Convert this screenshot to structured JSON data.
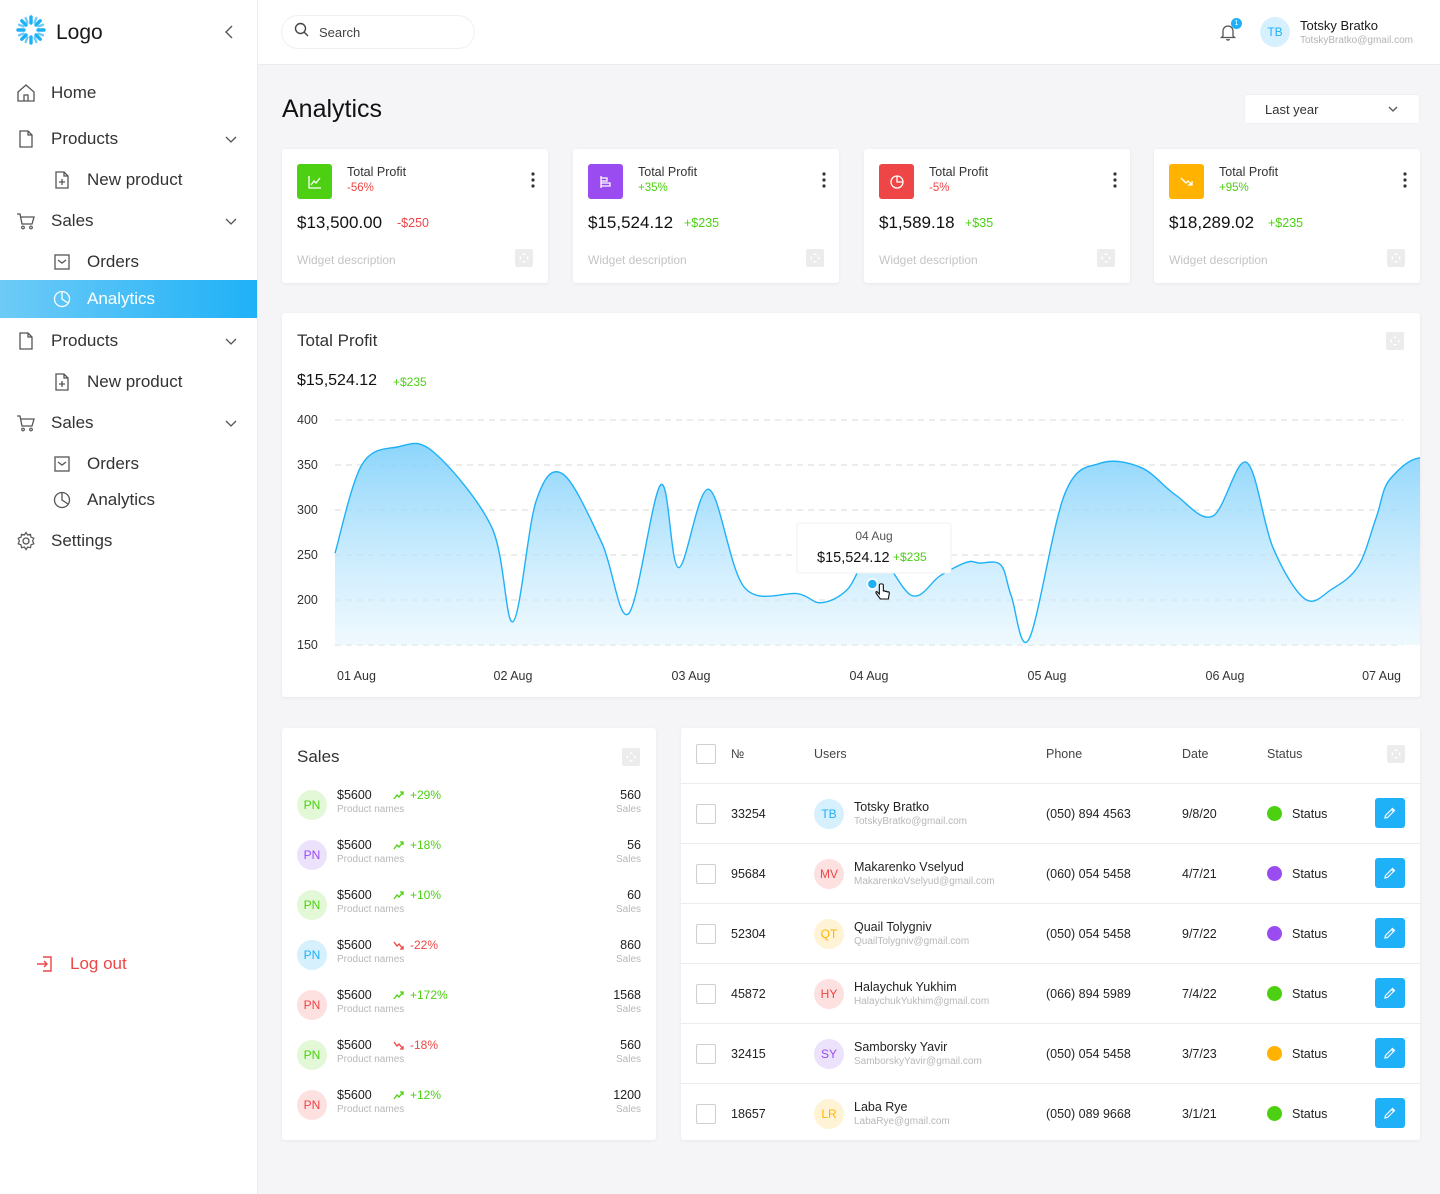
{
  "sidebar": {
    "logo": "Logo",
    "items": [
      {
        "label": "Home",
        "icon": "home-icon",
        "level": "top"
      },
      {
        "label": "Products",
        "icon": "file-icon",
        "level": "top",
        "expandable": true
      },
      {
        "label": "New product",
        "icon": "file-plus-icon",
        "level": "sub"
      },
      {
        "label": "Sales",
        "icon": "cart-icon",
        "level": "top",
        "expandable": true
      },
      {
        "label": "Orders",
        "icon": "inbox-icon",
        "level": "sub"
      },
      {
        "label": "Analytics",
        "icon": "pie-chart-icon",
        "level": "sub",
        "active": true
      },
      {
        "label": "Products",
        "icon": "file-icon",
        "level": "top",
        "expandable": true
      },
      {
        "label": "New product",
        "icon": "file-plus-icon",
        "level": "sub"
      },
      {
        "label": "Sales",
        "icon": "cart-icon",
        "level": "top",
        "expandable": true
      },
      {
        "label": "Orders",
        "icon": "inbox-icon",
        "level": "sub"
      },
      {
        "label": "Analytics",
        "icon": "pie-chart-icon",
        "level": "sub"
      },
      {
        "label": "Settings",
        "icon": "gear-icon",
        "level": "top"
      }
    ],
    "logout": "Log out"
  },
  "header": {
    "search_placeholder": "Search",
    "notification_count": "1",
    "user": {
      "initials": "TB",
      "name": "Totsky Bratko",
      "email": "TotskyBratko@gmail.com"
    }
  },
  "page": {
    "title": "Analytics",
    "period": "Last year"
  },
  "colors": {
    "accent": "#1fb1f7",
    "positive": "#4cd011",
    "negative": "#ee4646",
    "purple": "#8b5cf6",
    "orange": "#ffb300"
  },
  "stats": [
    {
      "label": "Total Profit",
      "percent": "-56%",
      "value": "$13,500.00",
      "delta": "-$250",
      "trend": "negative",
      "icon": "line-chart-icon",
      "color": "#4cd011",
      "description": "Widget description"
    },
    {
      "label": "Total Profit",
      "percent": "+35%",
      "value": "$15,524.12",
      "delta": "+$235",
      "trend": "positive",
      "icon": "bar-chart-icon",
      "color": "#9a4cf0",
      "description": "Widget description"
    },
    {
      "label": "Total Profit",
      "percent": "-5%",
      "value": "$1,589.18",
      "delta": "+$35",
      "trend": "negative",
      "icon": "pie-chart-icon",
      "color": "#ee4646",
      "description": "Widget description"
    },
    {
      "label": "Total Profit",
      "percent": "+95%",
      "value": "$18,289.02",
      "delta": "+$235",
      "trend": "positive",
      "icon": "trend-down-icon",
      "color": "#ffb300",
      "description": "Widget description"
    }
  ],
  "profit_chart": {
    "title": "Total Profit",
    "value": "$15,524.12",
    "delta": "+$235",
    "tooltip": {
      "date": "04 Aug",
      "value": "$15,524.12",
      "delta": "+$235"
    }
  },
  "chart_data": {
    "type": "area",
    "title": "Total Profit",
    "xlabel": "",
    "ylabel": "",
    "ylim": [
      150,
      400
    ],
    "yticks": [
      400,
      350,
      300,
      250,
      200,
      150
    ],
    "xticks": [
      "01 Aug",
      "02 Aug",
      "03 Aug",
      "04 Aug",
      "05 Aug",
      "06 Aug",
      "07 Aug"
    ],
    "grid": true,
    "series": [
      {
        "x": [
          0,
          0.15,
          0.35,
          0.55,
          0.88,
          1.0,
          1.13,
          1.28,
          1.5,
          1.65,
          1.83,
          1.93,
          2.1,
          2.3,
          2.6,
          2.73,
          2.88,
          3.03,
          3.24,
          3.4,
          3.55,
          3.62,
          3.74,
          3.8,
          3.9,
          4.1,
          4.3,
          4.53,
          4.72,
          4.93,
          5.12,
          5.27,
          5.45,
          5.6,
          5.75,
          5.85,
          5.93,
          6.14,
          6.42,
          6.7,
          6.9,
          7.0
        ],
        "y": [
          252,
          350,
          370,
          365,
          281,
          176,
          310,
          340,
          263,
          185,
          328,
          236,
          323,
          214,
          207,
          197,
          212,
          255,
          205,
          227,
          242,
          241,
          239,
          204,
          157,
          318,
          352,
          347,
          317,
          293,
          353,
          258,
          201,
          212,
          238,
          292,
          335,
          357,
          302,
          205,
          196,
          177
        ]
      }
    ]
  },
  "sales": {
    "title": "Sales",
    "rows": [
      {
        "initials": "PN",
        "amount": "$5600",
        "name": "Product names",
        "change": "+29%",
        "trend": "up",
        "count": "560",
        "count_label": "Sales",
        "bg": "#e2f8d7",
        "fg": "#4cd011"
      },
      {
        "initials": "PN",
        "amount": "$5600",
        "name": "Product names",
        "change": "+18%",
        "trend": "up",
        "count": "56",
        "count_label": "Sales",
        "bg": "#ece2fc",
        "fg": "#9a4cf0"
      },
      {
        "initials": "PN",
        "amount": "$5600",
        "name": "Product names",
        "change": "+10%",
        "trend": "up",
        "count": "60",
        "count_label": "Sales",
        "bg": "#e2f8d7",
        "fg": "#4cd011"
      },
      {
        "initials": "PN",
        "amount": "$5600",
        "name": "Product names",
        "change": "-22%",
        "trend": "down",
        "count": "860",
        "count_label": "Sales",
        "bg": "#d6f0fd",
        "fg": "#1fb1f7"
      },
      {
        "initials": "PN",
        "amount": "$5600",
        "name": "Product names",
        "change": "+172%",
        "trend": "up",
        "count": "1568",
        "count_label": "Sales",
        "bg": "#fde0e0",
        "fg": "#ee4646"
      },
      {
        "initials": "PN",
        "amount": "$5600",
        "name": "Product names",
        "change": "-18%",
        "trend": "down",
        "count": "560",
        "count_label": "Sales",
        "bg": "#e2f8d7",
        "fg": "#4cd011"
      },
      {
        "initials": "PN",
        "amount": "$5600",
        "name": "Product names",
        "change": "+12%",
        "trend": "up",
        "count": "1200",
        "count_label": "Sales",
        "bg": "#fde0e0",
        "fg": "#ee4646"
      }
    ]
  },
  "table": {
    "columns": {
      "number": "№",
      "users": "Users",
      "phone": "Phone",
      "date": "Date",
      "status": "Status"
    },
    "rows": [
      {
        "id": "33254",
        "initials": "TB",
        "name": "Totsky Bratko",
        "email": "TotskyBratko@gmail.com",
        "phone": "(050) 894 4563",
        "date": "9/8/20",
        "status": "Status",
        "status_color": "#4cd011",
        "bg": "#d6f0fd",
        "fg": "#1fb1f7"
      },
      {
        "id": "95684",
        "initials": "MV",
        "name": "Makarenko Vselyud",
        "email": "MakarenkoVselyud@gmail.com",
        "phone": "(060) 054 5458",
        "date": "4/7/21",
        "status": "Status",
        "status_color": "#9a4cf0",
        "bg": "#fde0e0",
        "fg": "#ee4646"
      },
      {
        "id": "52304",
        "initials": "QT",
        "name": "Quail Tolygniv",
        "email": "QuailTolygniv@gmail.com",
        "phone": "(050) 054 5458",
        "date": "9/7/22",
        "status": "Status",
        "status_color": "#9a4cf0",
        "bg": "#fff3d6",
        "fg": "#ffb300"
      },
      {
        "id": "45872",
        "initials": "HY",
        "name": "Halaychuk Yukhim",
        "email": "HalaychukYukhim@gmail.com",
        "phone": "(066) 894 5989",
        "date": "7/4/22",
        "status": "Status",
        "status_color": "#4cd011",
        "bg": "#fde0e0",
        "fg": "#ee4646"
      },
      {
        "id": "32415",
        "initials": "SY",
        "name": "Samborsky Yavir",
        "email": "SamborskyYavir@gmail.com",
        "phone": "(050) 054 5458",
        "date": "3/7/23",
        "status": "Status",
        "status_color": "#ffb300",
        "bg": "#ece2fc",
        "fg": "#9a4cf0"
      },
      {
        "id": "18657",
        "initials": "LR",
        "name": "Laba Rye",
        "email": "LabaRye@gmail.com",
        "phone": "(050) 089 9668",
        "date": "3/1/21",
        "status": "Status",
        "status_color": "#4cd011",
        "bg": "#fff3d6",
        "fg": "#ffb300"
      }
    ]
  }
}
